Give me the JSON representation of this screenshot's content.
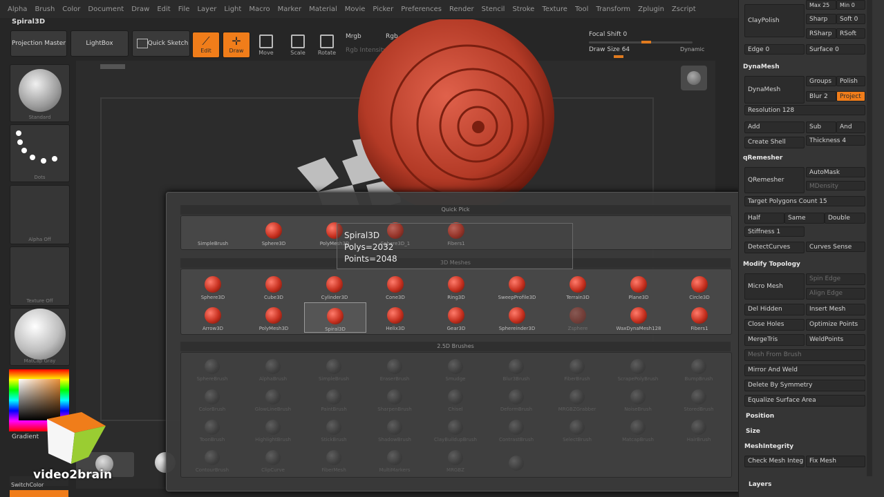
{
  "menu": [
    "Alpha",
    "Brush",
    "Color",
    "Document",
    "Draw",
    "Edit",
    "File",
    "Layer",
    "Light",
    "Macro",
    "Marker",
    "Material",
    "Movie",
    "Picker",
    "Preferences",
    "Render",
    "Stencil",
    "Stroke",
    "Texture",
    "Tool",
    "Transform",
    "Zplugin",
    "Zscript"
  ],
  "document_title": "Spiral3D",
  "shelf": {
    "projection_master": "Projection Master",
    "lightbox": "LightBox",
    "quick_sketch": "Quick Sketch",
    "edit": "Edit",
    "draw": "Draw",
    "move": "Move",
    "scale": "Scale",
    "rotate": "Rotate",
    "mrgb": "Mrgb",
    "rgb": "Rgb",
    "rgb_intensity": "Rgb Intensity",
    "focal_shift": "Focal Shift 0",
    "draw_size": "Draw Size 64",
    "dynamic": "Dynamic"
  },
  "left_shelf": {
    "brush": "Standard",
    "stroke": "Dots",
    "alpha": "Alpha Off",
    "texture": "Texture Off",
    "material": "MatCap Gray",
    "gradient": "Gradient",
    "switch_color": "SwitchColor"
  },
  "quick_pick": {
    "title": "Quick Pick",
    "items": [
      "SimpleBrush",
      "Sphere3D",
      "PolyMesh3D",
      "Sphere3D_1",
      "Fibers1"
    ]
  },
  "tooltip": {
    "name": "Spiral3D",
    "polys": "Polys=2032",
    "points": "Points=2048"
  },
  "meshes": {
    "title": "3D Meshes",
    "row1": [
      "Sphere3D",
      "Cube3D",
      "Cylinder3D",
      "Cone3D",
      "Ring3D",
      "SweepProfile3D",
      "Terrain3D",
      "Plane3D",
      "Circle3D"
    ],
    "row2": [
      "Arrow3D",
      "PolyMesh3D",
      "Spiral3D",
      "Helix3D",
      "Gear3D",
      "Sphereinder3D",
      "Zsphere",
      "WaxDynaMesh128",
      "Fibers1"
    ]
  },
  "brushes": {
    "title": "2.5D Brushes",
    "items": [
      "SphereBrush",
      "AlphaBrush",
      "SimpleBrush",
      "EraserBrush",
      "Smudge",
      "Blur3Brush",
      "FiberBrush",
      "ScrapePolyBrush",
      "BumpBrush",
      "ColorBrush",
      "GlowLineBrush",
      "PaintBrush",
      "SharpenBrush",
      "Chisel",
      "DeformBrush",
      "MRGBZGrabber",
      "NoiseBrush",
      "StoredBrush",
      "ToonBrush",
      "HighlightBrush",
      "StickBrush",
      "ShadowBrush",
      "ClayBuildupBrush",
      "ContrastBrush",
      "SelectBrush",
      "MatcapBrush",
      "HairBrush",
      "ContourBrush",
      "ClipCurve",
      "FiberMesh",
      "MultiMarkers",
      "MRGBZ",
      ""
    ]
  },
  "right_panel": {
    "claypolish": "ClayPolish",
    "max_angle": "Max 25",
    "min": "Min 0",
    "sharp": "Sharp",
    "soft": "Soft 0",
    "rsharp": "RSharp",
    "rsoft": "RSoft",
    "edge": "Edge 0",
    "surface": "Surface 0",
    "dynamesh_header": "DynaMesh",
    "dynamesh": "DynaMesh",
    "groups": "Groups",
    "polish": "Polish",
    "blur": "Blur 2",
    "project": "Project",
    "resolution": "Resolution 128",
    "add": "Add",
    "sub": "Sub",
    "and": "And",
    "create_shell": "Create Shell",
    "thickness": "Thickness 4",
    "qremesher_header": "qRemesher",
    "qremesher": "QRemesher",
    "automask": "AutoMask",
    "mdensity": "MDensity",
    "target_polygons": "Target Polygons Count 15",
    "half": "Half",
    "same": "Same",
    "double": "Double",
    "stiffness": "Stiffness 1",
    "detect_curves": "DetectCurves",
    "curves_sense": "Curves Sense",
    "modify_topology": "Modify Topology",
    "micro_mesh": "Micro Mesh",
    "spin_edge": "Spin Edge",
    "align_edge": "Align Edge",
    "del_hidden": "Del Hidden",
    "insert_mesh": "Insert Mesh",
    "close_holes": "Close Holes",
    "optimize_points": "Optimize Points",
    "merge_tris": "MergeTris",
    "weld_points": "WeldPoints",
    "mesh_from_brush": "Mesh From Brush",
    "mirror_and_weld": "Mirror And Weld",
    "delete_by_symmetry": "Delete By Symmetry",
    "equalize_surface_area": "Equalize Surface Area",
    "position": "Position",
    "size": "Size",
    "mesh_integrity": "MeshIntegrity",
    "check_mesh": "Check Mesh Integrity",
    "fix_mesh": "Fix Mesh",
    "layers": "Layers"
  },
  "watermark": "video2brain"
}
